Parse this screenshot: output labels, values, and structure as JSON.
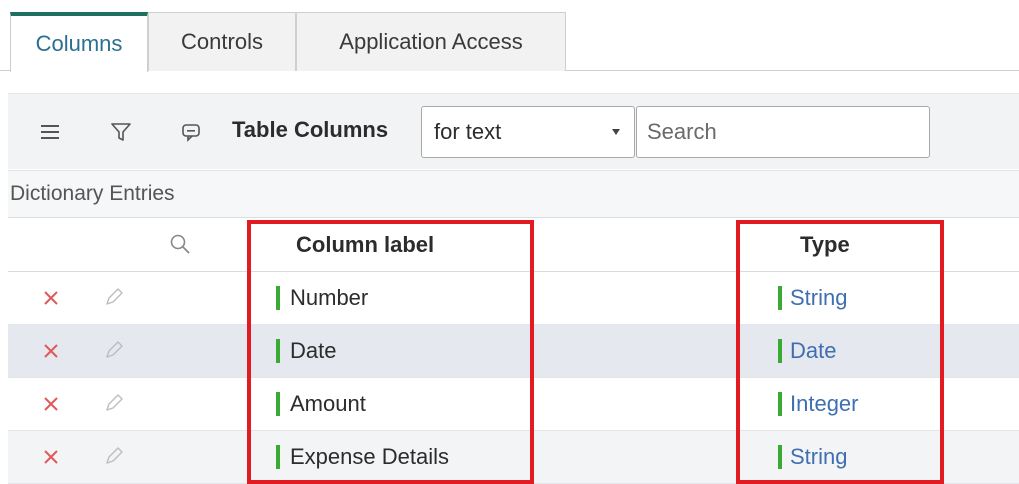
{
  "tabs": [
    {
      "label": "Columns",
      "active": true
    },
    {
      "label": "Controls",
      "active": false
    },
    {
      "label": "Application Access",
      "active": false
    }
  ],
  "toolbar": {
    "title": "Table Columns",
    "select_value": "for text",
    "search_placeholder": "Search",
    "icons": [
      "menu-icon",
      "filter-icon",
      "comment-icon"
    ]
  },
  "section": {
    "label": "Dictionary Entries"
  },
  "table": {
    "headers": {
      "column_label": "Column label",
      "type": "Type"
    },
    "rows": [
      {
        "label": "Number",
        "type": "String"
      },
      {
        "label": "Date",
        "type": "Date"
      },
      {
        "label": "Amount",
        "type": "Integer"
      },
      {
        "label": "Expense Details",
        "type": "String"
      }
    ]
  },
  "colors": {
    "accent": "#1d6f5f",
    "status_bar": "#3aaa35",
    "link": "#3f6fb0",
    "delete": "#e05a5a",
    "highlight": "#e21b22"
  }
}
